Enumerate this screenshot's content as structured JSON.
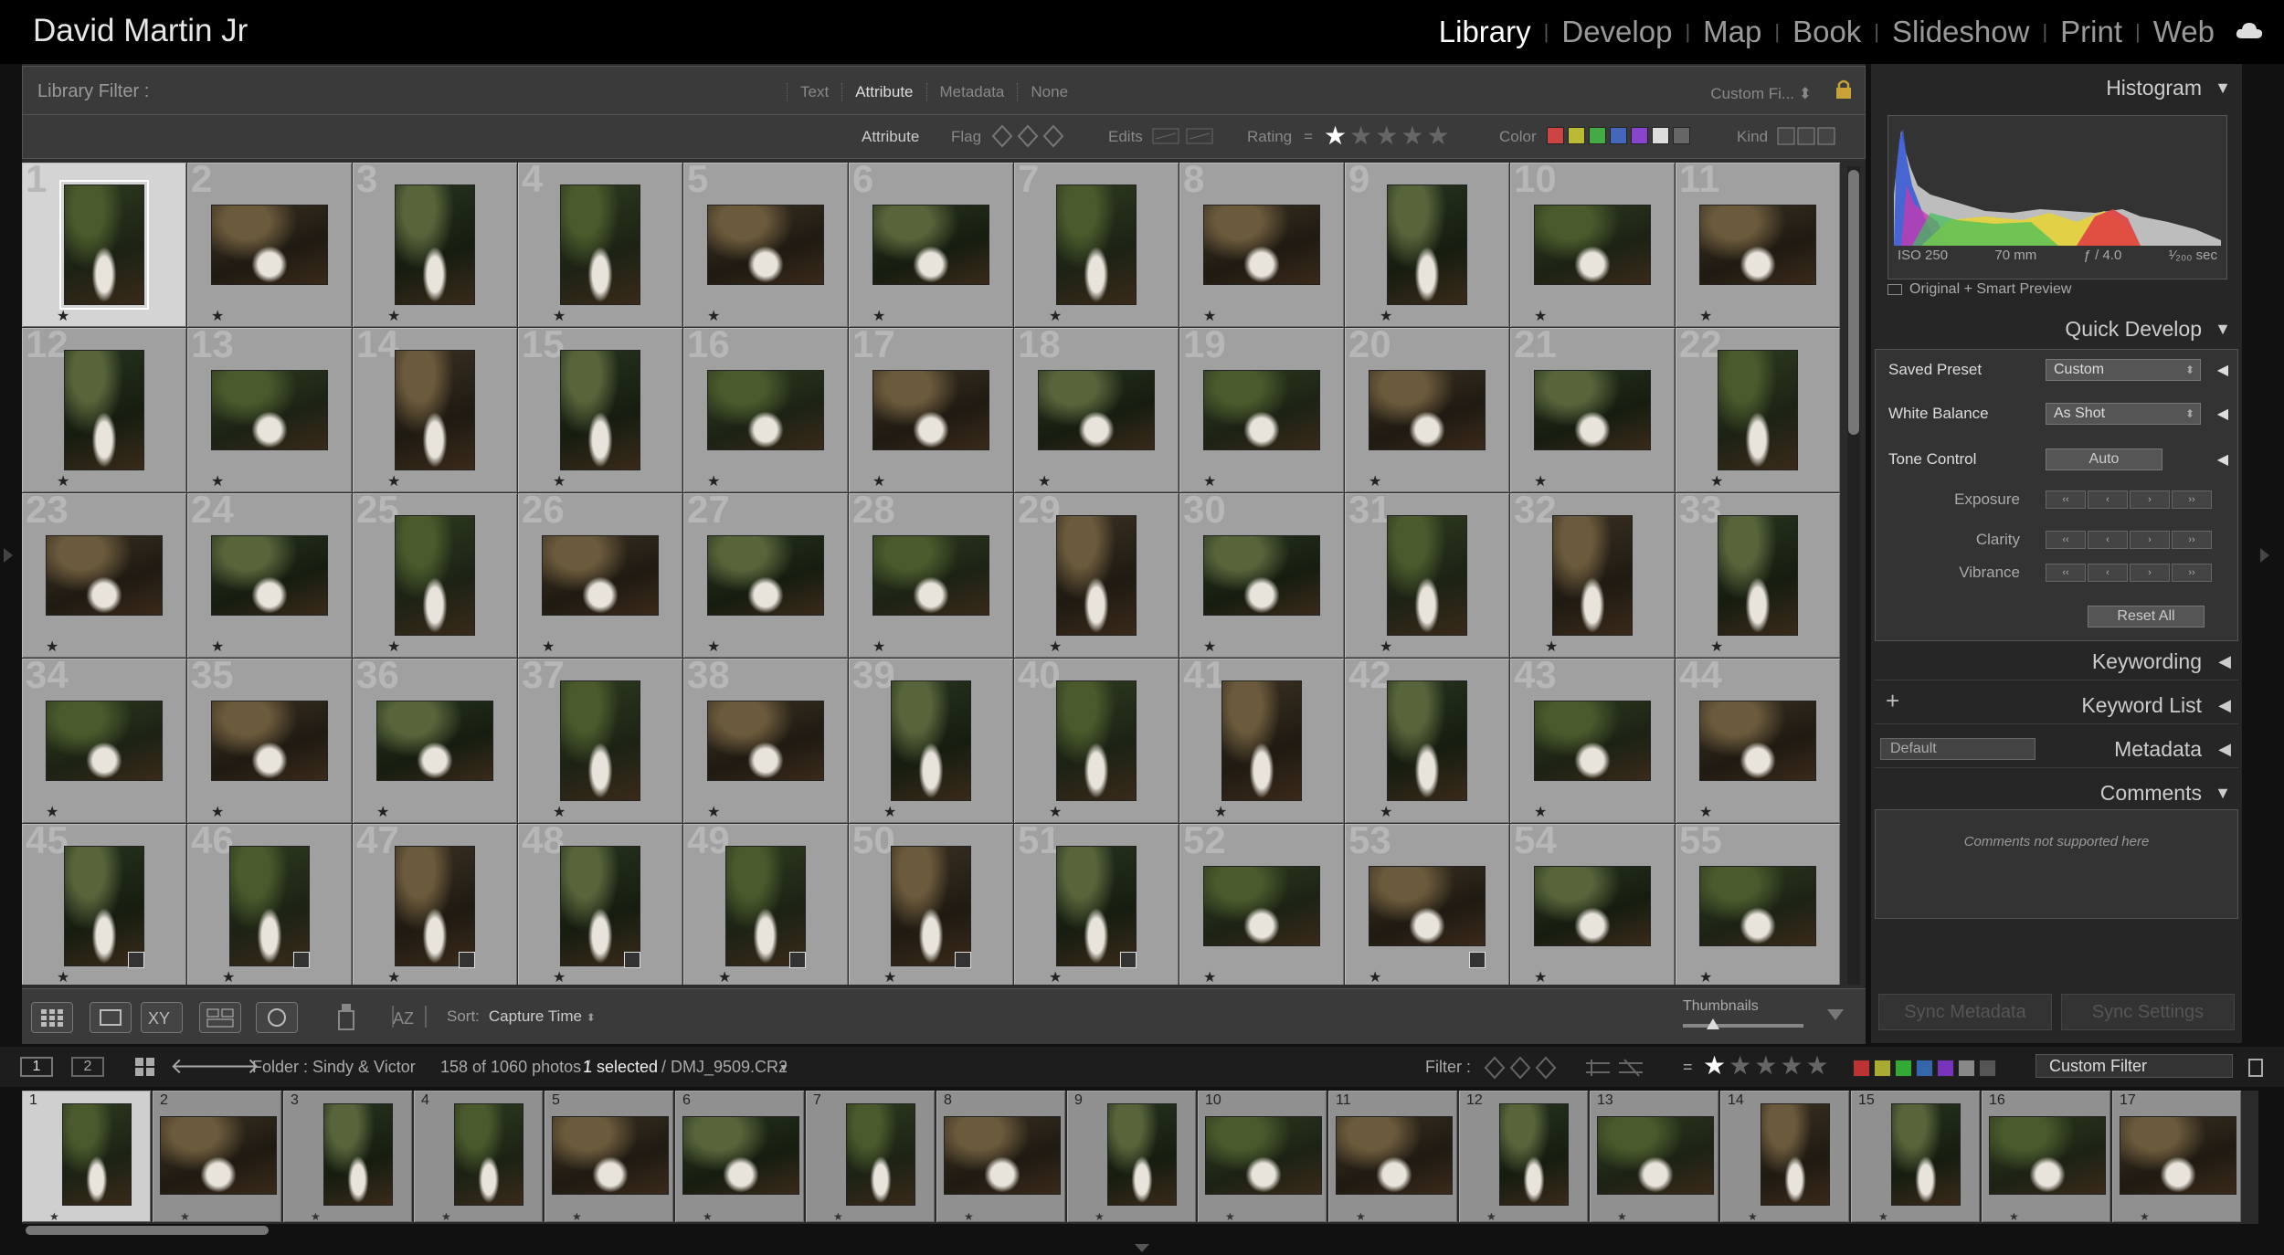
{
  "app": {
    "identity_plate": "David Martin Jr",
    "modules": [
      "Library",
      "Develop",
      "Map",
      "Book",
      "Slideshow",
      "Print",
      "Web"
    ],
    "active_module": "Library"
  },
  "library_filter": {
    "label": "Library Filter :",
    "tabs": [
      "Text",
      "Attribute",
      "Metadata",
      "None"
    ],
    "active_tab": "Attribute",
    "preset": "Custom Fi..."
  },
  "attribute_bar": {
    "label": "Attribute",
    "flag_label": "Flag",
    "edits_label": "Edits",
    "rating_label": "Rating",
    "rating_op": "=",
    "rating_value": 1,
    "color_label": "Color",
    "color_swatches": [
      "#c44",
      "#bb3",
      "#4a4",
      "#46b",
      "#84c",
      "#ddd",
      "#666"
    ],
    "kind_label": "Kind"
  },
  "grid": {
    "cells": [
      {
        "n": "1",
        "o": "p",
        "s": true
      },
      {
        "n": "2",
        "o": "l"
      },
      {
        "n": "3",
        "o": "p"
      },
      {
        "n": "4",
        "o": "p"
      },
      {
        "n": "5",
        "o": "l"
      },
      {
        "n": "6",
        "o": "l"
      },
      {
        "n": "7",
        "o": "p"
      },
      {
        "n": "8",
        "o": "l"
      },
      {
        "n": "9",
        "o": "p"
      },
      {
        "n": "10",
        "o": "l"
      },
      {
        "n": "11",
        "o": "l"
      },
      {
        "n": "12",
        "o": "p"
      },
      {
        "n": "13",
        "o": "l"
      },
      {
        "n": "14",
        "o": "p"
      },
      {
        "n": "15",
        "o": "p"
      },
      {
        "n": "16",
        "o": "l"
      },
      {
        "n": "17",
        "o": "l"
      },
      {
        "n": "18",
        "o": "l"
      },
      {
        "n": "19",
        "o": "l"
      },
      {
        "n": "20",
        "o": "l"
      },
      {
        "n": "21",
        "o": "l"
      },
      {
        "n": "22",
        "o": "p"
      },
      {
        "n": "23",
        "o": "l"
      },
      {
        "n": "24",
        "o": "l"
      },
      {
        "n": "25",
        "o": "p"
      },
      {
        "n": "26",
        "o": "l"
      },
      {
        "n": "27",
        "o": "l"
      },
      {
        "n": "28",
        "o": "l"
      },
      {
        "n": "29",
        "o": "p"
      },
      {
        "n": "30",
        "o": "l"
      },
      {
        "n": "31",
        "o": "p"
      },
      {
        "n": "32",
        "o": "p"
      },
      {
        "n": "33",
        "o": "p"
      },
      {
        "n": "34",
        "o": "l"
      },
      {
        "n": "35",
        "o": "l"
      },
      {
        "n": "36",
        "o": "l"
      },
      {
        "n": "37",
        "o": "p"
      },
      {
        "n": "38",
        "o": "l"
      },
      {
        "n": "39",
        "o": "p"
      },
      {
        "n": "40",
        "o": "p"
      },
      {
        "n": "41",
        "o": "p"
      },
      {
        "n": "42",
        "o": "p"
      },
      {
        "n": "43",
        "o": "l"
      },
      {
        "n": "44",
        "o": "l"
      },
      {
        "n": "45",
        "o": "p",
        "b": true
      },
      {
        "n": "46",
        "o": "p",
        "b": true
      },
      {
        "n": "47",
        "o": "p",
        "b": true
      },
      {
        "n": "48",
        "o": "p",
        "b": true
      },
      {
        "n": "49",
        "o": "p",
        "b": true
      },
      {
        "n": "50",
        "o": "p",
        "b": true
      },
      {
        "n": "51",
        "o": "p",
        "b": true
      },
      {
        "n": "52",
        "o": "l"
      },
      {
        "n": "53",
        "o": "l",
        "b": true
      },
      {
        "n": "54",
        "o": "l"
      },
      {
        "n": "55",
        "o": "l"
      }
    ],
    "star": "★"
  },
  "toolbar": {
    "sort_label": "Sort:",
    "sort_value": "Capture Time",
    "thumbnails_label": "Thumbnails",
    "thumbnail_size": 0.25
  },
  "right_panel": {
    "histogram": {
      "title": "Histogram",
      "iso": "ISO 250",
      "focal": "70 mm",
      "aperture": "ƒ / 4.0",
      "shutter": "¹⁄₂₀₀ sec",
      "preview": "Original + Smart Preview"
    },
    "quick_develop": {
      "title": "Quick Develop",
      "saved_preset_label": "Saved Preset",
      "saved_preset_value": "Custom",
      "white_balance_label": "White Balance",
      "white_balance_value": "As Shot",
      "tone_control_label": "Tone Control",
      "auto_label": "Auto",
      "exposure_label": "Exposure",
      "clarity_label": "Clarity",
      "vibrance_label": "Vibrance",
      "reset_label": "Reset All"
    },
    "keywording_title": "Keywording",
    "keyword_list_title": "Keyword List",
    "metadata_title": "Metadata",
    "metadata_preset": "Default",
    "comments_title": "Comments",
    "comments_note": "Comments not supported here",
    "sync_metadata": "Sync Metadata",
    "sync_settings": "Sync Settings"
  },
  "filmstrip_bar": {
    "screen1": "1",
    "screen2": "2",
    "folder": "Folder : Sindy & Victor",
    "count": "158 of 1060 photos /",
    "selected": "1 selected",
    "filename": "/ DMJ_9509.CR2",
    "filter_label": "Filter :",
    "rating_op": "=",
    "custom_filter": "Custom Filter",
    "color_swatches": [
      "#b33",
      "#aa3",
      "#3a3",
      "#36a",
      "#73b",
      "#888",
      "#555"
    ]
  },
  "filmstrip": {
    "cells": [
      {
        "n": "1",
        "o": "p",
        "s": true
      },
      {
        "n": "2",
        "o": "l"
      },
      {
        "n": "3",
        "o": "p"
      },
      {
        "n": "4",
        "o": "p"
      },
      {
        "n": "5",
        "o": "l"
      },
      {
        "n": "6",
        "o": "l"
      },
      {
        "n": "7",
        "o": "p"
      },
      {
        "n": "8",
        "o": "l"
      },
      {
        "n": "9",
        "o": "p"
      },
      {
        "n": "10",
        "o": "l"
      },
      {
        "n": "11",
        "o": "l"
      },
      {
        "n": "12",
        "o": "p"
      },
      {
        "n": "13",
        "o": "l"
      },
      {
        "n": "14",
        "o": "p"
      },
      {
        "n": "15",
        "o": "p"
      },
      {
        "n": "16",
        "o": "l"
      },
      {
        "n": "17",
        "o": "l"
      }
    ]
  }
}
